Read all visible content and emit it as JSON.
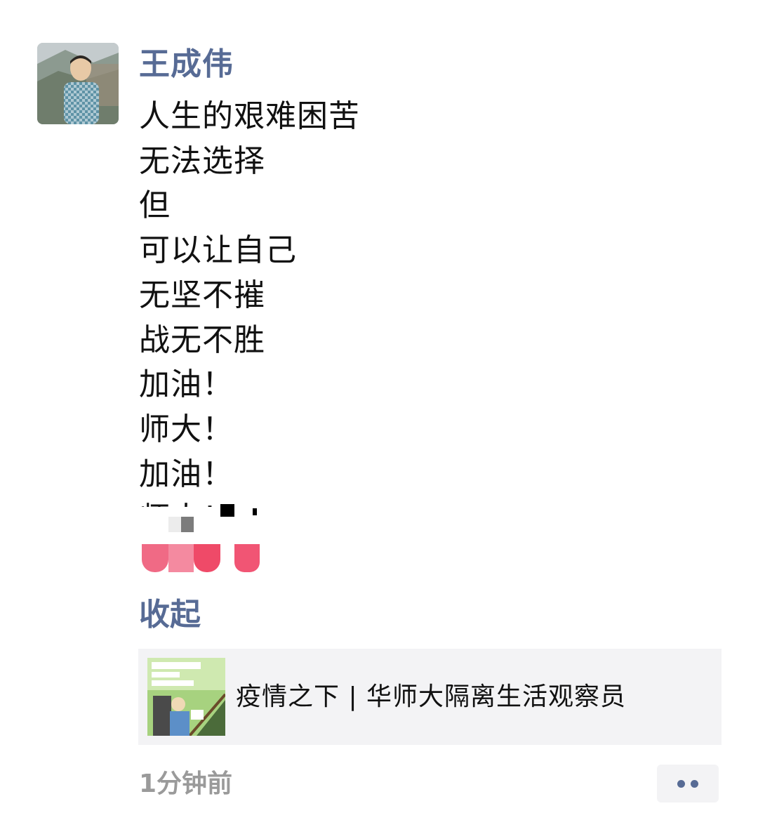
{
  "post": {
    "author": "王成伟",
    "lines": [
      "人生的艰难困苦",
      "无法选择",
      "但",
      "可以让自己",
      "无坚不摧",
      "战无不胜",
      "加油！",
      "师大！",
      "加油！",
      "师大！"
    ],
    "collapse_label": "收起",
    "link": {
      "title": "疫情之下 | 华师大隔离生活观察员",
      "thumbnail_icon": "article-comic-thumbnail"
    },
    "timestamp": "1分钟前",
    "more_icon": "more-dots-icon"
  },
  "colors": {
    "link_blue": "#576b95",
    "text": "#111111",
    "muted": "#9a9a9a",
    "card_bg": "#f3f3f5",
    "emoji_red": "#ef4a68"
  }
}
